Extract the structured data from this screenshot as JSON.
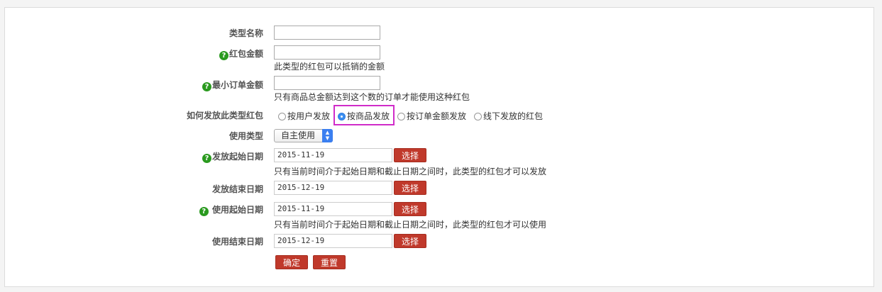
{
  "form": {
    "type_name": {
      "label": "类型名称",
      "value": ""
    },
    "amount": {
      "label": "红包金额",
      "value": "",
      "note": "此类型的红包可以抵销的金额"
    },
    "min_amount": {
      "label": "最小订单金额",
      "value": "",
      "note": "只有商品总金额达到这个数的订单才能使用这种红包"
    },
    "send_method": {
      "label": "如何发放此类型红包",
      "options": [
        "按用户发放",
        "按商品发放",
        "按订单金额发放",
        "线下发放的红包"
      ],
      "selected": "按商品发放"
    },
    "use_type": {
      "label": "使用类型",
      "value": "自主使用"
    },
    "send_start": {
      "label": "发放起始日期",
      "value": "2015-11-19",
      "button": "选择",
      "note": "只有当前时间介于起始日期和截止日期之间时，此类型的红包才可以发放"
    },
    "send_end": {
      "label": "发放结束日期",
      "value": "2015-12-19",
      "button": "选择"
    },
    "use_start": {
      "label": "使用起始日期",
      "value": "2015-11-19",
      "button": "选择",
      "note": "只有当前时间介于起始日期和截止日期之间时，此类型的红包才可以使用"
    },
    "use_end": {
      "label": "使用结束日期",
      "value": "2015-12-19",
      "button": "选择"
    },
    "confirm_label": "确定",
    "reset_label": "重置"
  },
  "help_icon": "?",
  "colors": {
    "button_red": "#c0392b",
    "help_green": "#2a9a1f",
    "highlight": "#d02cc9"
  }
}
